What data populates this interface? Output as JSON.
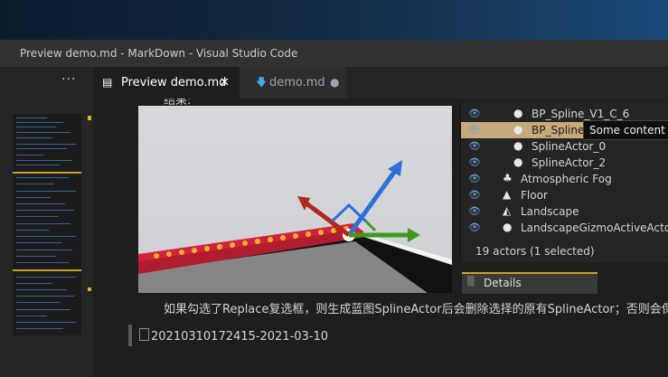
{
  "window": {
    "title": "Preview demo.md - MarkDown - Visual Studio Code"
  },
  "sidebar": {
    "more_label": "···"
  },
  "tabs": [
    {
      "label": "Preview demo.md",
      "icon": "preview-icon",
      "close": "✕"
    },
    {
      "label": "demo.md",
      "icon": "markdown-file-icon",
      "dirty": "●"
    }
  ],
  "preview": {
    "top_cut_text": "结果:",
    "paragraph": "如果勾选了Replace复选框，则生成蓝图SplineActor后会删除选择的原有SplineActor；否则会保留",
    "broken_image_alt": "20210310172415-2021-03-10",
    "outliner": {
      "items": [
        {
          "label": "BP_Spline_V1_C_6",
          "icon": "sphere-icon",
          "indent": 1,
          "selected": false
        },
        {
          "label": "BP_Spline",
          "icon": "sphere-icon",
          "indent": 1,
          "selected": true
        },
        {
          "label": "SplineActor_0",
          "icon": "spline-actor-icon",
          "indent": 1,
          "selected": false
        },
        {
          "label": "SplineActor_2",
          "icon": "spline-actor-icon",
          "indent": 1,
          "selected": false
        },
        {
          "label": "Atmospheric Fog",
          "icon": "fog-icon",
          "indent": 0,
          "selected": false
        },
        {
          "label": "Floor",
          "icon": "floor-icon",
          "indent": 0,
          "selected": false
        },
        {
          "label": "Landscape",
          "icon": "landscape-icon",
          "indent": 0,
          "selected": false
        },
        {
          "label": "LandscapeGizmoActiveActor",
          "icon": "gizmo-actor-icon",
          "indent": 0,
          "selected": false
        }
      ],
      "tooltip": "Some content h",
      "count": "19 actors (1 selected)",
      "details_tab": "Details"
    }
  },
  "colors": {
    "editor_bg": "#1e1e1e",
    "sidebar_bg": "#252526",
    "titlebar_bg": "#323233",
    "selection": "#c8a97c",
    "accent_yellow": "#c9a227"
  }
}
